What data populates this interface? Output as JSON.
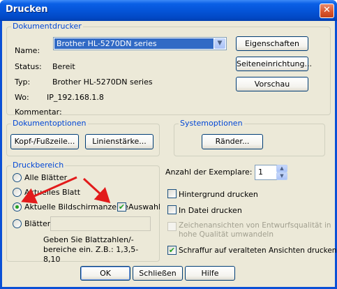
{
  "window": {
    "title": "Drucken",
    "close_symbol": "✕"
  },
  "printer_group": {
    "legend": "Dokumentdrucker",
    "name_label": "Name:",
    "name_value": "Brother HL-5270DN series",
    "status_label": "Status:",
    "status_value": "Bereit",
    "type_label": "Typ:",
    "type_value": "Brother HL-5270DN series",
    "where_label": "Wo:",
    "where_value": "IP_192.168.1.8",
    "comment_label": "Kommentar:",
    "comment_value": "",
    "properties_button": "Eigenschaften",
    "page_setup_button": "Seiteneinrichtung...",
    "preview_button": "Vorschau"
  },
  "document_options": {
    "legend": "Dokumentoptionen",
    "header_footer_button": "Kopf-/Fußzeile...",
    "line_width_button": "Linienstärke..."
  },
  "system_options": {
    "legend": "Systemoptionen",
    "margins_button": "Ränder..."
  },
  "print_range": {
    "legend": "Druckbereich",
    "all_sheets": "Alle Blätter",
    "active_sheet": "Aktuelles Blatt",
    "current_view": "Aktuelle Bildschirmanzeige",
    "selection": "Auswahl",
    "sheets": "Blätter:",
    "sheets_value": "",
    "hint": "Geben Sie Blattzahlen/-bereiche ein. Z.B.: 1,3,5-8,10",
    "selected": "current_view",
    "selection_checked": true
  },
  "copies": {
    "label": "Anzahl der Exemplare:",
    "value": "1"
  },
  "options": {
    "background": {
      "label": "Hintergrund drucken",
      "checked": false
    },
    "to_file": {
      "label": "In Datei drucken",
      "checked": false
    },
    "draft_quality": {
      "label": "Zeichenansichten von Entwurfsqualität in hohe Qualität umwandeln",
      "checked": false,
      "disabled": true
    },
    "hatching": {
      "label": "Schraffur auf veralteten Ansichten drucken",
      "checked": true
    }
  },
  "footer": {
    "ok": "OK",
    "close": "Schließen",
    "help": "Hilfe"
  },
  "colors": {
    "title_bar": "#0453d6",
    "dialog_bg": "#ece9d8",
    "legend_text": "#0046d5",
    "annotation_arrows": "#e21b1b"
  }
}
